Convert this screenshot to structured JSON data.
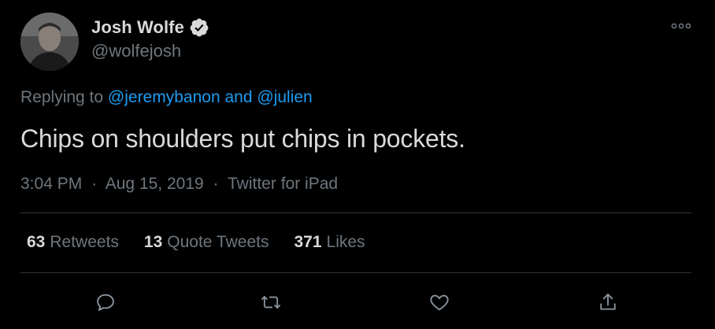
{
  "author": {
    "display_name": "Josh Wolfe",
    "handle": "@wolfejosh",
    "verified": true
  },
  "reply": {
    "prefix": "Replying to",
    "mention_1": "@jeremybanon",
    "joiner": "and",
    "mention_2": "@julien"
  },
  "tweet": {
    "text": "Chips on shoulders put chips in pockets.",
    "time": "3:04 PM",
    "date": "Aug 15, 2019",
    "source": "Twitter for iPad",
    "separator": "·"
  },
  "stats": {
    "retweets_count": "63",
    "retweets_label": "Retweets",
    "quotes_count": "13",
    "quotes_label": "Quote Tweets",
    "likes_count": "371",
    "likes_label": "Likes"
  },
  "actions": [
    "reply-icon",
    "retweet-icon",
    "like-icon",
    "share-icon"
  ],
  "colors": {
    "background": "#000000",
    "text": "#d9d9d9",
    "muted": "#6e767d",
    "link": "#1d9bf0",
    "divider": "#2f3336"
  }
}
